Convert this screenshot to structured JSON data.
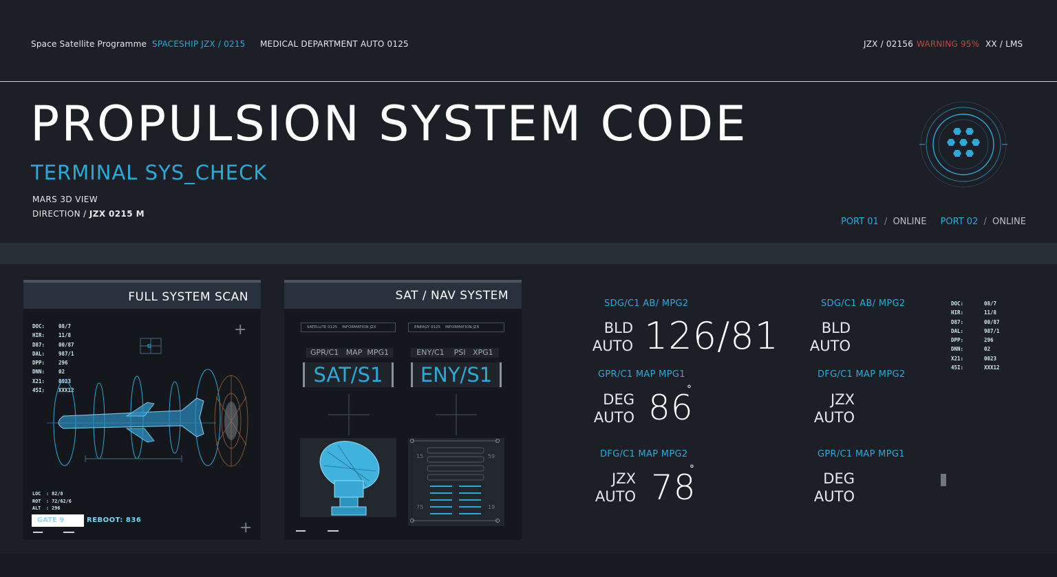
{
  "topbar": {
    "program": "Space Satellite Programme",
    "spaceship": "SPACESHIP  JZX / 0215",
    "medical": "MEDICAL DEPARTMENT AUTO 0125",
    "code": "JZX / 02156",
    "warning": "WARNING  95%",
    "mode": "XX / LMS"
  },
  "header": {
    "title": "PROPULSION SYSTEM CODE",
    "subtitle": "TERMINAL SYS_CHECK",
    "view": "MARS 3D VIEW",
    "direction_label": "DIRECTION /",
    "direction_value": "JZX 0215  M"
  },
  "ports": {
    "port1": "PORT 01",
    "port1_status": "ONLINE",
    "port2": "PORT 02",
    "port2_status": "ONLINE",
    "sep": "/"
  },
  "scan_panel": {
    "title": "FULL SYSTEM SCAN",
    "stats": [
      {
        "k": "DOC:",
        "v": "08/7"
      },
      {
        "k": "HIR:",
        "v": "11/8"
      },
      {
        "k": "D87:",
        "v": "00/87"
      },
      {
        "k": "DAL:",
        "v": "987/1"
      },
      {
        "k": "DPP:",
        "v": "296"
      },
      {
        "k": "DNN:",
        "v": "02"
      },
      {
        "k": "X21:",
        "v": "0023"
      },
      {
        "k": "45I:",
        "v": "XXX12"
      }
    ],
    "loc": [
      {
        "k": "LOC",
        "v": ": 82/8"
      },
      {
        "k": "ROT",
        "v": ": 72/62/6"
      },
      {
        "k": "ALT",
        "v": ": 296"
      }
    ],
    "gate": "GATE 9",
    "reboot": "REBOOT: 836"
  },
  "nav_panel": {
    "title": "SAT / NAV SYSTEM",
    "left": {
      "tab": "SATELLITE 0125",
      "info": "INFORMATION JZX",
      "tags": "GPR/C1   MAP  MPG1",
      "code": "SAT/S1"
    },
    "right": {
      "tab": "ENERGY 0125",
      "info": "INFORMATION JZX",
      "tags": "ENY/C1    PSI   XPG1",
      "code": "ENY/S1"
    },
    "scale_left_top": "15",
    "scale_right_top": "59",
    "scale_left_bottom": "75",
    "scale_right_bottom": "19"
  },
  "readouts": {
    "r1_tag": "SDG/C1   AB/  MPG2",
    "r1_label_a": "BLD",
    "r1_label_b": "AUTO",
    "r1_value": "126/81",
    "r2_tag": "GPR/C1   MAP   MPG1",
    "r2_label_a": "DEG",
    "r2_label_b": "AUTO",
    "r2_value": "86",
    "r3_tag": "DFG/C1   MAP   MPG2",
    "r3_label_a": "JZX",
    "r3_label_b": "AUTO",
    "r3_value": "78",
    "r4_tag": "SDG/C1   AB/  MPG2",
    "r4_label_a": "BLD",
    "r4_label_b": "AUTO",
    "r5_tag": "DFG/C1   MAP   MPG2",
    "r5_label_a": "JZX",
    "r5_label_b": "AUTO",
    "r6_tag": "GPR/C1   MAP   MPG1",
    "r6_label_a": "DEG",
    "r6_label_b": "AUTO",
    "degree": "°"
  },
  "side_stats": [
    {
      "k": "DOC:",
      "v": "08/7"
    },
    {
      "k": "HIR:",
      "v": "11/8"
    },
    {
      "k": "D87:",
      "v": "00/87"
    },
    {
      "k": "DAL:",
      "v": "987/1"
    },
    {
      "k": "DPP:",
      "v": "296"
    },
    {
      "k": "DNN:",
      "v": "02"
    },
    {
      "k": "X21:",
      "v": "0023"
    },
    {
      "k": "45I:",
      "v": "XXX12"
    }
  ],
  "colors": {
    "accent": "#2ba9d8",
    "warning": "#c0473f",
    "bg": "#1c2026",
    "panel": "#14171b"
  }
}
